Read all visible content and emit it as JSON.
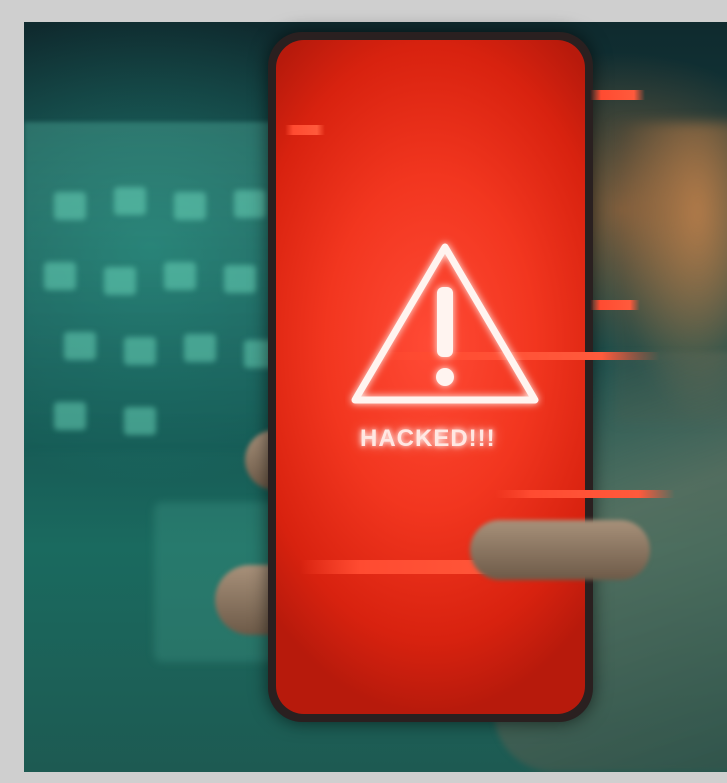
{
  "phone_screen": {
    "message": "HACKED!!!"
  },
  "icons": {
    "warning": "warning-triangle-icon"
  },
  "colors": {
    "screen_red": "#f2361f",
    "warning_glow": "#ffffff",
    "background_teal": "#14494a"
  }
}
